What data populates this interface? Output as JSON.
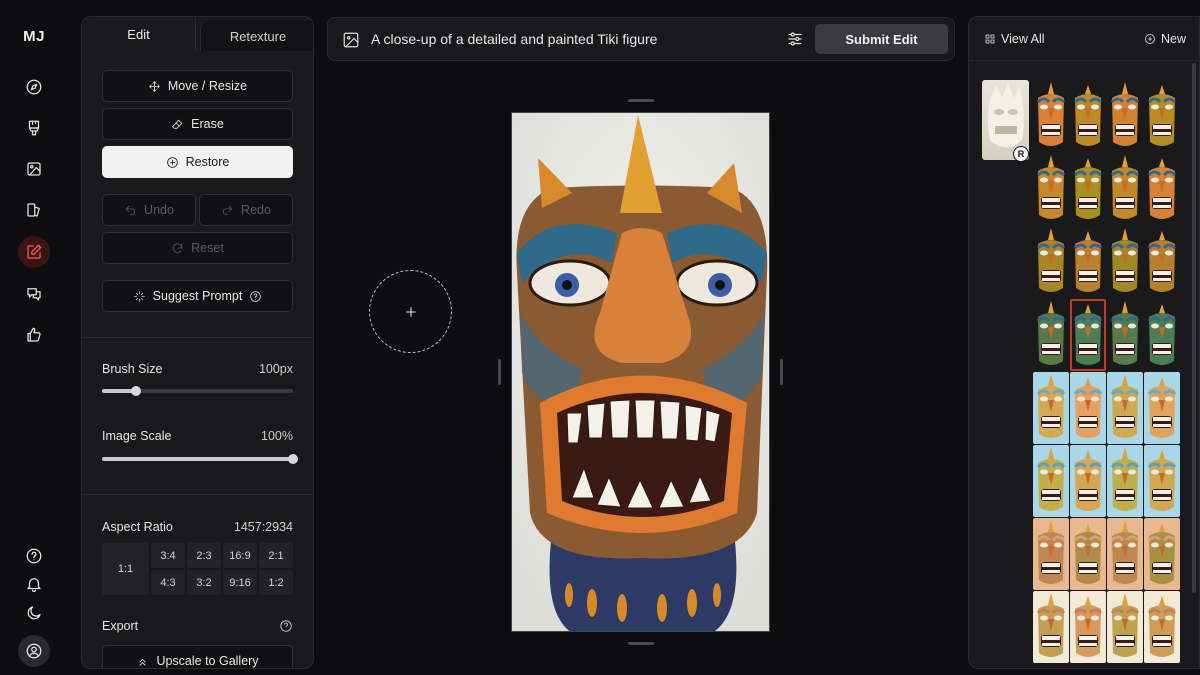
{
  "app": {
    "logo": "MJ"
  },
  "rail": {
    "items": [
      {
        "name": "explore-icon"
      },
      {
        "name": "create-icon"
      },
      {
        "name": "gallery-icon"
      },
      {
        "name": "organize-icon"
      },
      {
        "name": "edit-icon",
        "active": true
      },
      {
        "name": "chat-icon"
      },
      {
        "name": "rate-icon"
      }
    ],
    "bottom": [
      "help-icon",
      "bell-icon",
      "moon-icon",
      "user-icon"
    ]
  },
  "panel": {
    "tabs": [
      "Edit",
      "Retexture"
    ],
    "tools": {
      "move": "Move / Resize",
      "erase": "Erase",
      "restore": "Restore",
      "undo": "Undo",
      "redo": "Redo",
      "reset": "Reset",
      "suggest": "Suggest Prompt"
    },
    "brush_size": {
      "label": "Brush Size",
      "value": "100px",
      "fraction": 0.18
    },
    "image_scale": {
      "label": "Image Scale",
      "value": "100%",
      "fraction": 1.0
    },
    "aspect_ratio": {
      "label": "Aspect Ratio",
      "value": "1457:2934",
      "square": "1:1",
      "top_row": [
        "3:4",
        "2:3",
        "16:9",
        "2:1"
      ],
      "bottom_row": [
        "4:3",
        "3:2",
        "9:16",
        "1:2"
      ]
    },
    "export": {
      "label": "Export",
      "upscale": "Upscale to Gallery"
    }
  },
  "prompt": {
    "text": "A close-up of a detailed and painted Tiki figure",
    "submit": "Submit Edit"
  },
  "gallery": {
    "view_all": "View All",
    "new": "New",
    "reference_badge": "R"
  },
  "colors": {
    "accent_active": "#ff5555",
    "panel_bg": "#19191c",
    "page_bg": "#0d0d0f",
    "selected_outline": "#c0392b"
  }
}
